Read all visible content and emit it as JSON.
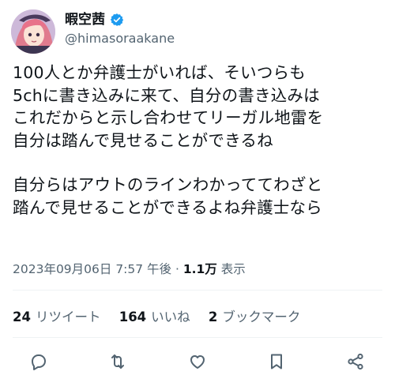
{
  "author": {
    "display_name": "暇空茜",
    "handle": "@himasoraakane",
    "verified_icon": "verified-badge-icon"
  },
  "tweet": {
    "paragraph1": "100人とか弁護士がいれば、そいつらも\n5chに書き込みに来て、自分の書き込みは\nこれだからと示し合わせてリーガル地雷を\n自分は踏んで見せることができるね",
    "paragraph2": "自分らはアウトのラインわかっててわざと\n踏んで見せることができるよね弁護士なら"
  },
  "meta": {
    "timestamp": "2023年09月06日 7:57 午後",
    "separator": " · ",
    "views_count": "1.1万",
    "views_label": " 表示"
  },
  "stats": {
    "retweets_count": "24",
    "retweets_label": "リツイート",
    "likes_count": "164",
    "likes_label": "いいね",
    "bookmarks_count": "2",
    "bookmarks_label": "ブックマーク"
  },
  "actions": [
    "reply-icon",
    "retweet-icon",
    "like-icon",
    "bookmark-icon",
    "share-icon"
  ],
  "colors": {
    "verified": "#1d9bf0",
    "muted": "#536471",
    "text": "#0f1419"
  }
}
